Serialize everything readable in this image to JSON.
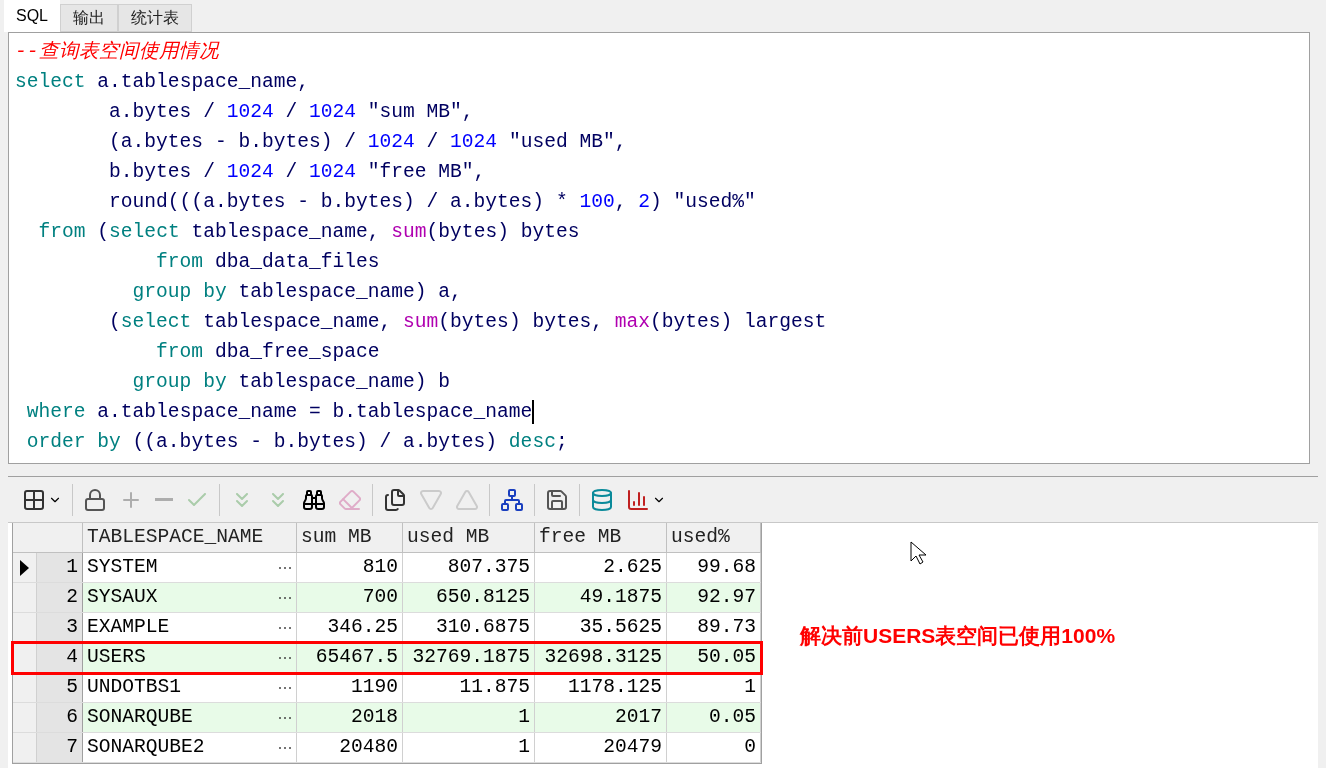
{
  "tabs": [
    {
      "label": "SQL",
      "selected": true
    },
    {
      "label": "输出",
      "selected": false
    },
    {
      "label": "统计表",
      "selected": false
    }
  ],
  "editor": {
    "lines": [
      {
        "cursor": false,
        "tokens": [
          {
            "kind": "comment",
            "text": "--查询表空间使用情况"
          }
        ]
      },
      {
        "cursor": false,
        "tokens": [
          {
            "kind": "kw",
            "text": "select"
          },
          {
            "kind": "plain",
            "text": " a.tablespace_name,"
          }
        ]
      },
      {
        "cursor": false,
        "tokens": [
          {
            "kind": "plain",
            "text": "        a.bytes / "
          },
          {
            "kind": "num",
            "text": "1024"
          },
          {
            "kind": "plain",
            "text": " / "
          },
          {
            "kind": "num",
            "text": "1024"
          },
          {
            "kind": "plain",
            "text": " \"sum MB\","
          }
        ]
      },
      {
        "cursor": false,
        "tokens": [
          {
            "kind": "plain",
            "text": "        (a.bytes - b.bytes) / "
          },
          {
            "kind": "num",
            "text": "1024"
          },
          {
            "kind": "plain",
            "text": " / "
          },
          {
            "kind": "num",
            "text": "1024"
          },
          {
            "kind": "plain",
            "text": " \"used MB\","
          }
        ]
      },
      {
        "cursor": false,
        "tokens": [
          {
            "kind": "plain",
            "text": "        b.bytes / "
          },
          {
            "kind": "num",
            "text": "1024"
          },
          {
            "kind": "plain",
            "text": " / "
          },
          {
            "kind": "num",
            "text": "1024"
          },
          {
            "kind": "plain",
            "text": " \"free MB\","
          }
        ]
      },
      {
        "cursor": false,
        "tokens": [
          {
            "kind": "plain",
            "text": "        round(((a.bytes - b.bytes) / a.bytes) * "
          },
          {
            "kind": "num",
            "text": "100"
          },
          {
            "kind": "plain",
            "text": ", "
          },
          {
            "kind": "num",
            "text": "2"
          },
          {
            "kind": "plain",
            "text": ") \"used%\""
          }
        ]
      },
      {
        "cursor": false,
        "tokens": [
          {
            "kind": "kw",
            "text": "  from"
          },
          {
            "kind": "plain",
            "text": " ("
          },
          {
            "kind": "kw",
            "text": "select"
          },
          {
            "kind": "plain",
            "text": " tablespace_name, "
          },
          {
            "kind": "fn",
            "text": "sum"
          },
          {
            "kind": "plain",
            "text": "(bytes) bytes"
          }
        ]
      },
      {
        "cursor": false,
        "tokens": [
          {
            "kind": "kw",
            "text": "            from"
          },
          {
            "kind": "plain",
            "text": " dba_data_files"
          }
        ]
      },
      {
        "cursor": false,
        "tokens": [
          {
            "kind": "kw",
            "text": "          group by"
          },
          {
            "kind": "plain",
            "text": " tablespace_name) a,"
          }
        ]
      },
      {
        "cursor": false,
        "tokens": [
          {
            "kind": "plain",
            "text": "        ("
          },
          {
            "kind": "kw",
            "text": "select"
          },
          {
            "kind": "plain",
            "text": " tablespace_name, "
          },
          {
            "kind": "fn",
            "text": "sum"
          },
          {
            "kind": "plain",
            "text": "(bytes) bytes, "
          },
          {
            "kind": "fn",
            "text": "max"
          },
          {
            "kind": "plain",
            "text": "(bytes) largest"
          }
        ]
      },
      {
        "cursor": false,
        "tokens": [
          {
            "kind": "kw",
            "text": "            from"
          },
          {
            "kind": "plain",
            "text": " dba_free_space"
          }
        ]
      },
      {
        "cursor": false,
        "tokens": [
          {
            "kind": "kw",
            "text": "          group by"
          },
          {
            "kind": "plain",
            "text": " tablespace_name) b"
          }
        ]
      },
      {
        "cursor": true,
        "tokens": [
          {
            "kind": "kw",
            "text": " where"
          },
          {
            "kind": "plain",
            "text": " a.tablespace_name = b.tablespace_name"
          }
        ]
      },
      {
        "cursor": false,
        "tokens": [
          {
            "kind": "kw",
            "text": " order by"
          },
          {
            "kind": "plain",
            "text": " ((a.bytes - b.bytes) / a.bytes) "
          },
          {
            "kind": "kw",
            "text": "desc"
          },
          {
            "kind": "plain",
            "text": ";"
          }
        ]
      }
    ]
  },
  "toolbar": [
    {
      "kind": "grid",
      "disabled": false,
      "menu": true
    },
    {
      "kind": "sep"
    },
    {
      "kind": "lock",
      "disabled": false,
      "menu": false
    },
    {
      "kind": "plus",
      "disabled": true,
      "menu": false
    },
    {
      "kind": "minus",
      "disabled": true,
      "menu": false
    },
    {
      "kind": "check",
      "disabled": true,
      "menu": false
    },
    {
      "kind": "sep"
    },
    {
      "kind": "fetch-next",
      "disabled": true,
      "menu": false
    },
    {
      "kind": "fetch-last",
      "disabled": true,
      "menu": false
    },
    {
      "kind": "find",
      "disabled": false,
      "menu": false
    },
    {
      "kind": "eraser",
      "disabled": true,
      "menu": false
    },
    {
      "kind": "sep"
    },
    {
      "kind": "records",
      "disabled": false,
      "menu": false
    },
    {
      "kind": "down",
      "disabled": true,
      "menu": false
    },
    {
      "kind": "up",
      "disabled": true,
      "menu": false
    },
    {
      "kind": "sep"
    },
    {
      "kind": "tree",
      "disabled": false,
      "menu": false
    },
    {
      "kind": "sep"
    },
    {
      "kind": "save",
      "disabled": false,
      "menu": false
    },
    {
      "kind": "sep"
    },
    {
      "kind": "database",
      "disabled": false,
      "menu": false
    },
    {
      "kind": "chart",
      "disabled": false,
      "menu": true
    }
  ],
  "grid": {
    "columns": [
      "TABLESPACE_NAME",
      "sum MB",
      "used MB",
      "free MB",
      "used%"
    ],
    "rows": [
      {
        "num": "1",
        "current": true,
        "highlighted": false,
        "cells": [
          "SYSTEM",
          "810",
          "807.375",
          "2.625",
          "99.68"
        ]
      },
      {
        "num": "2",
        "current": false,
        "highlighted": false,
        "cells": [
          "SYSAUX",
          "700",
          "650.8125",
          "49.1875",
          "92.97"
        ]
      },
      {
        "num": "3",
        "current": false,
        "highlighted": false,
        "cells": [
          "EXAMPLE",
          "346.25",
          "310.6875",
          "35.5625",
          "89.73"
        ]
      },
      {
        "num": "4",
        "current": false,
        "highlighted": true,
        "cells": [
          "USERS",
          "65467.5",
          "32769.1875",
          "32698.3125",
          "50.05"
        ]
      },
      {
        "num": "5",
        "current": false,
        "highlighted": false,
        "cells": [
          "UNDOTBS1",
          "1190",
          "11.875",
          "1178.125",
          "1"
        ]
      },
      {
        "num": "6",
        "current": false,
        "highlighted": false,
        "cells": [
          "SONARQUBE",
          "2018",
          "1",
          "2017",
          "0.05"
        ]
      },
      {
        "num": "7",
        "current": false,
        "highlighted": false,
        "cells": [
          "SONARQUBE2",
          "20480",
          "1",
          "20479",
          "0"
        ]
      }
    ]
  },
  "annotation": "解决前USERS表空间已使用100%"
}
